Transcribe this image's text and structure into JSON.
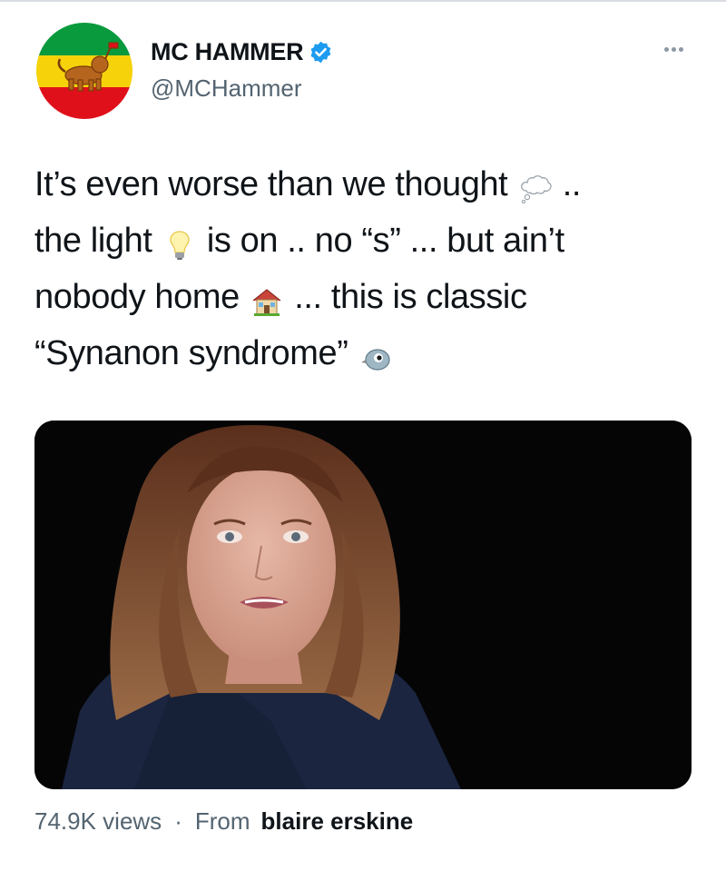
{
  "author": {
    "display_name": "MC HAMMER",
    "handle": "@MCHammer",
    "verified": true,
    "avatar_icon": "lion-of-judah-flag-avatar",
    "avatar_colors": [
      "#0a9a3e",
      "#f5d20a",
      "#e0101a"
    ]
  },
  "menu": {
    "icon": "more-horizontal-icon"
  },
  "tweet": {
    "lines": [
      {
        "before": "It’s even worse than we thought",
        "emoji": "thought-balloon",
        "after": " .."
      },
      {
        "before": "the light",
        "emoji": "light-bulb",
        "after": " is on .. no “s” ... but ain’t"
      },
      {
        "before": "nobody home",
        "emoji": "house",
        "after": "... this is classic"
      },
      {
        "before": "“Synanon syndrome”",
        "emoji": "bird-face",
        "after": ""
      }
    ]
  },
  "media": {
    "type": "video",
    "background": "#050506"
  },
  "footer": {
    "views": "74.9K views",
    "separator": "·",
    "from_label": "From",
    "source": "blaire erskine"
  },
  "colors": {
    "text_primary": "#0f1419",
    "text_secondary": "#536471",
    "verified_blue": "#1d9bf0"
  }
}
